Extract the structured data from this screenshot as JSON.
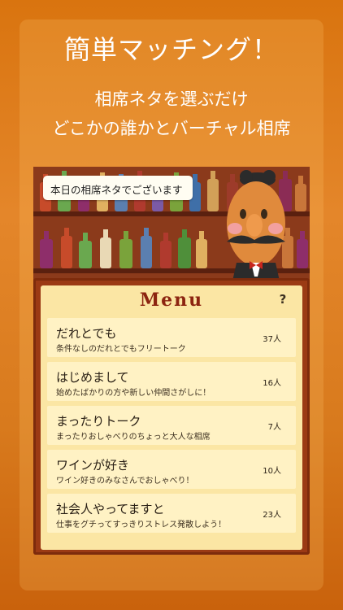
{
  "header": {
    "title": "簡単マッチング！",
    "subtitle_line1": "相席ネタを選ぶだけ",
    "subtitle_line2": "どこかの誰かとバーチャル相席"
  },
  "scene": {
    "speech": "本日の相席ネタでございます"
  },
  "menu": {
    "title": "Menu",
    "help": "?",
    "items": [
      {
        "title": "だれとでも",
        "desc": "条件なしのだれとでもフリートーク",
        "count": "37人"
      },
      {
        "title": "はじめまして",
        "desc": "始めたばかりの方や新しい仲間さがしに！",
        "count": "16人"
      },
      {
        "title": "まったりトーク",
        "desc": "まったりおしゃべりのちょっと大人な相席",
        "count": "7人"
      },
      {
        "title": "ワインが好き",
        "desc": "ワイン好きのみなさんでおしゃべり！",
        "count": "10人"
      },
      {
        "title": "社会人やってますと",
        "desc": "仕事をグチってすっきりストレス発散しよう！",
        "count": "23人"
      }
    ]
  }
}
